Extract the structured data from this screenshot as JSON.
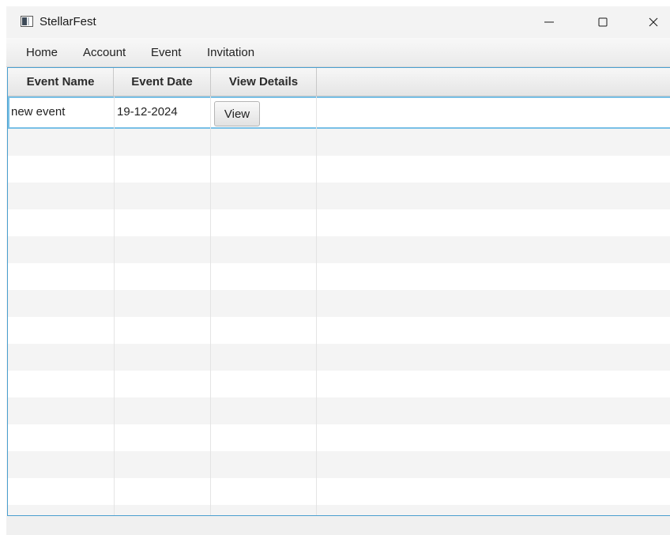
{
  "window": {
    "title": "StellarFest"
  },
  "menu": {
    "items": [
      "Home",
      "Account",
      "Event",
      "Invitation"
    ]
  },
  "table": {
    "columns": [
      "Event Name",
      "Event Date",
      "View Details"
    ],
    "rows": [
      {
        "event_name": "new event",
        "event_date": "19-12-2024",
        "action_label": "View"
      }
    ]
  },
  "colors": {
    "accent_border": "#4a9fcf",
    "selection_border": "#79c0e6",
    "stripe": "#f4f4f4"
  },
  "icons": [
    "app-icon",
    "minimize-icon",
    "maximize-icon",
    "close-icon"
  ]
}
